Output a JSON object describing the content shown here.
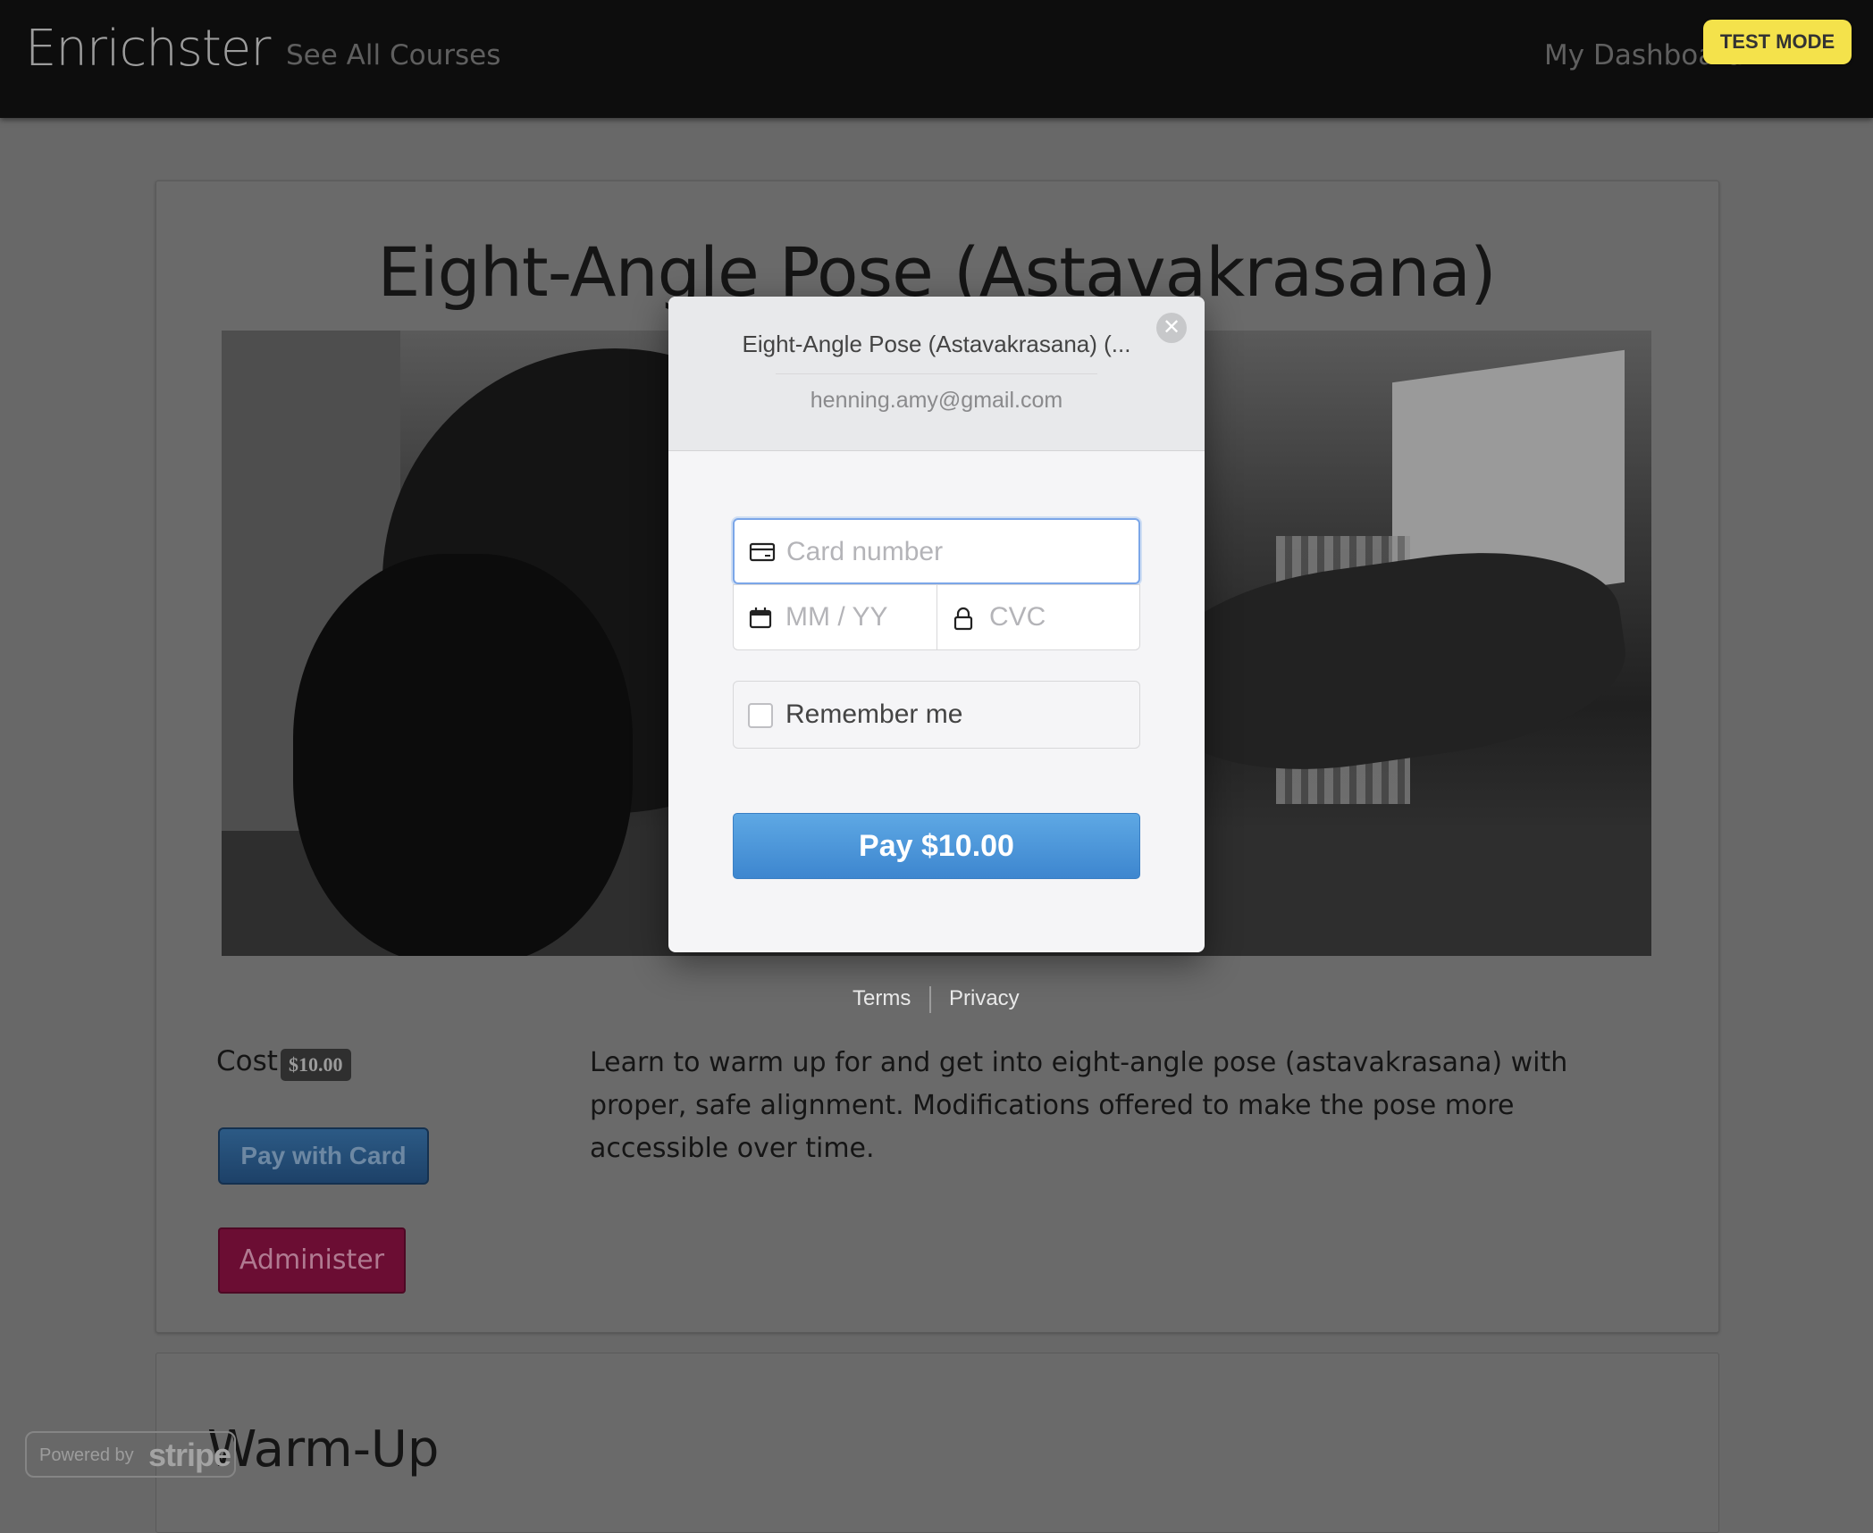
{
  "navbar": {
    "brand": "Enrichster",
    "see_all_courses": "See All Courses",
    "my_dashboard": "My Dashboard",
    "test_mode_badge": "TEST MODE"
  },
  "course": {
    "title": "Eight-Angle Pose (Astavakrasana)",
    "cost_label": "Cost:",
    "cost_value": "$10.00",
    "description": "Learn to warm up for and get into eight-angle pose (astavakrasana) with proper, safe alignment. Modifications offered to make the pose more accessible over time.",
    "pay_with_card_label": "Pay with Card",
    "administer_label": "Administer",
    "next_section_title": "Warm-Up"
  },
  "stripe_badge": {
    "powered_by": "Powered by",
    "wordmark": "stripe"
  },
  "checkout_modal": {
    "title": "Eight-Angle Pose (Astavakrasana) (...",
    "email": "henning.amy@gmail.com",
    "card_number_placeholder": "Card number",
    "expiry_placeholder": "MM / YY",
    "cvc_placeholder": "CVC",
    "remember_me_label": "Remember me",
    "remember_me_checked": false,
    "pay_button_label": "Pay $10.00",
    "footer_terms": "Terms",
    "footer_privacy": "Privacy",
    "accent_color": "#4a97dc"
  },
  "icons": {
    "close": "close-icon",
    "card": "credit-card-icon",
    "calendar": "calendar-icon",
    "lock": "lock-icon"
  }
}
